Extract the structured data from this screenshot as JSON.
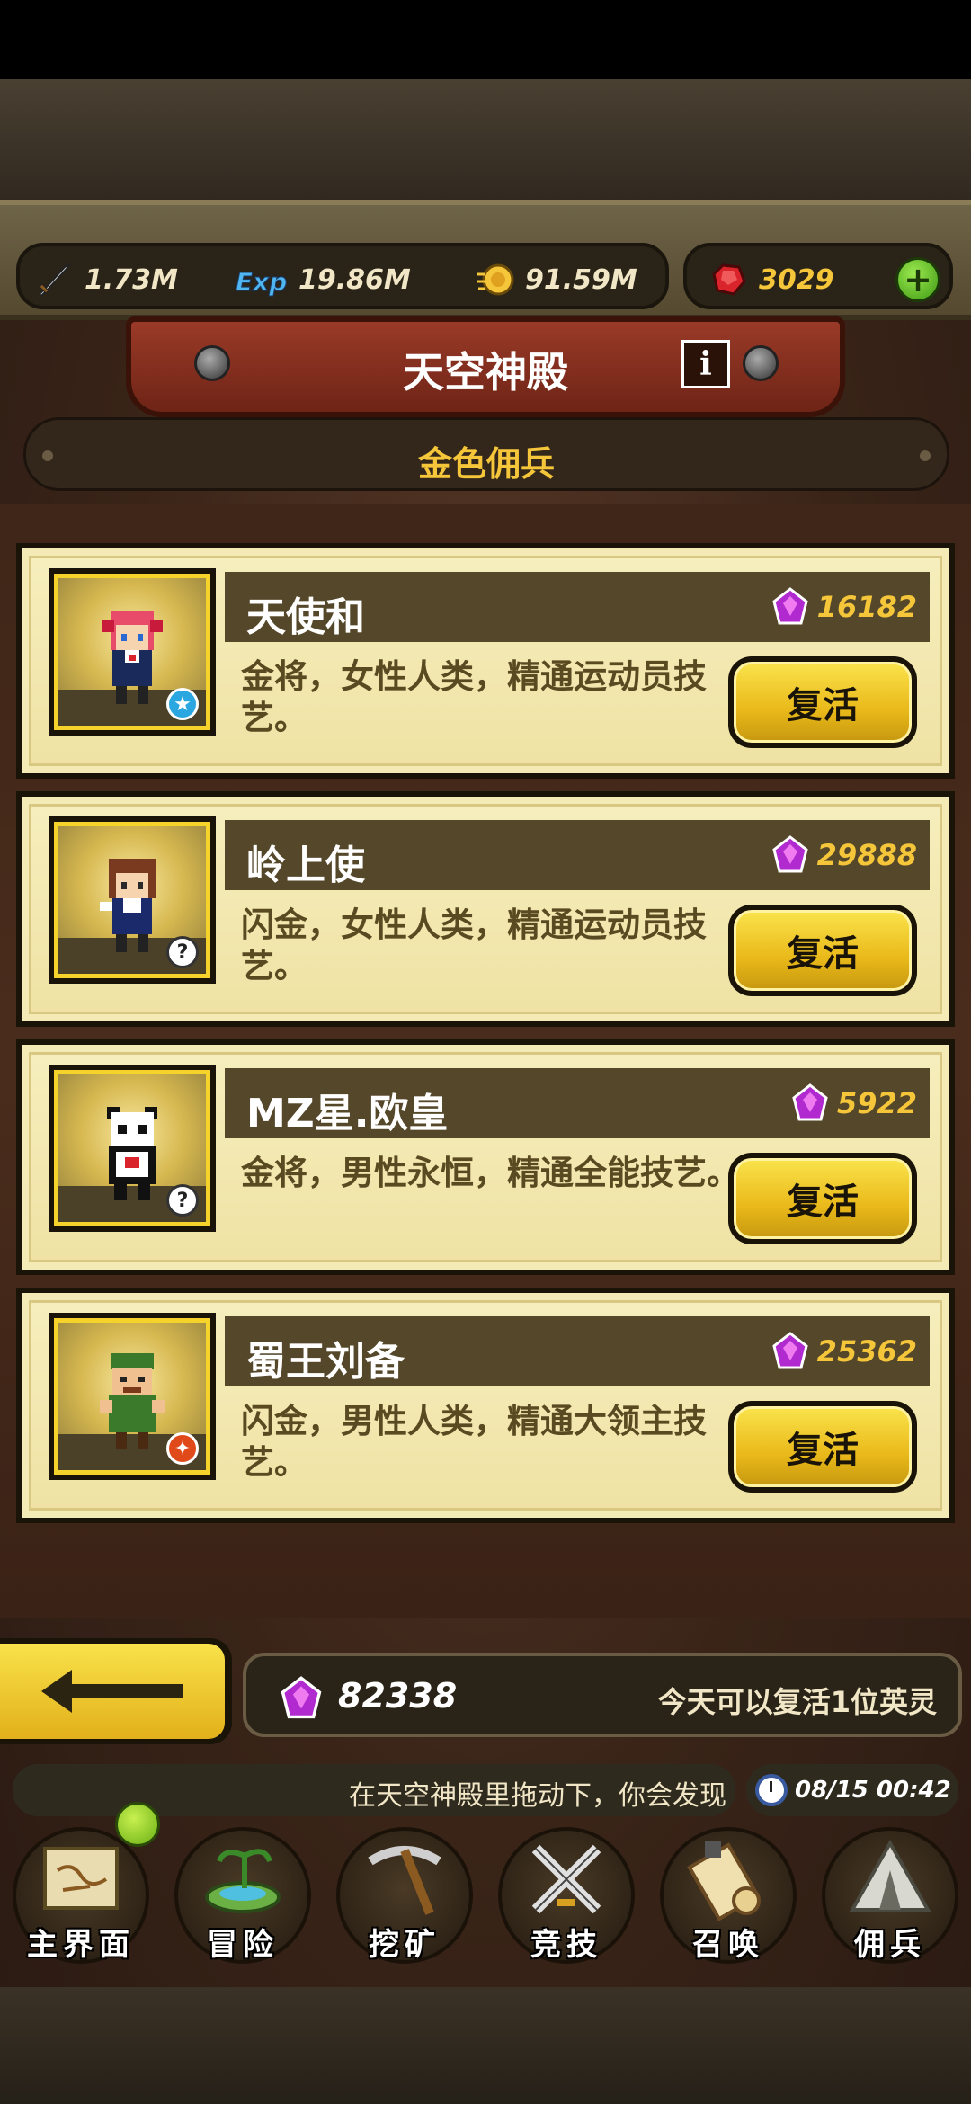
{
  "resources": {
    "attack": "1.73M",
    "exp_icon_label": "Exp",
    "exp": "19.86M",
    "gold": "91.59M",
    "rubies": "3029"
  },
  "header": {
    "title": "天空神殿",
    "info_icon": "i"
  },
  "subtitle": "金色佣兵",
  "mercenaries": [
    {
      "name": "天使和",
      "cost": "16182",
      "desc": "金将，女性人类，精通运动员技艺。",
      "button": "复活",
      "badge": "star"
    },
    {
      "name": "岭上使",
      "cost": "29888",
      "desc": "闪金，女性人类，精通运动员技艺。",
      "button": "复活",
      "badge": "?"
    },
    {
      "name": "MZ星.欧皇",
      "cost": "5922",
      "desc": "金将，男性永恒，精通全能技艺。",
      "button": "复活",
      "badge": "?"
    },
    {
      "name": "蜀王刘备",
      "cost": "25362",
      "desc": "闪金，男性人类，精通大领主技艺。",
      "button": "复活",
      "badge": "fire"
    }
  ],
  "footer": {
    "total_gems": "82338",
    "note": "今天可以复活1位英灵"
  },
  "ticker": "在天空神殿里拖动下，你会发现",
  "clock": "08/15 00:42",
  "nav": [
    {
      "label": "主界面",
      "icon": "map-scroll-icon"
    },
    {
      "label": "冒险",
      "icon": "island-icon"
    },
    {
      "label": "挖矿",
      "icon": "pickaxe-icon"
    },
    {
      "label": "竞技",
      "icon": "crossed-swords-icon"
    },
    {
      "label": "召唤",
      "icon": "scroll-icon"
    },
    {
      "label": "佣兵",
      "icon": "tent-icon"
    }
  ],
  "colors": {
    "gold_text": "#f5c53a",
    "button_yellow": "#f9e24a",
    "card_bg": "#f4eab6",
    "banner_red": "#9a3a28"
  }
}
